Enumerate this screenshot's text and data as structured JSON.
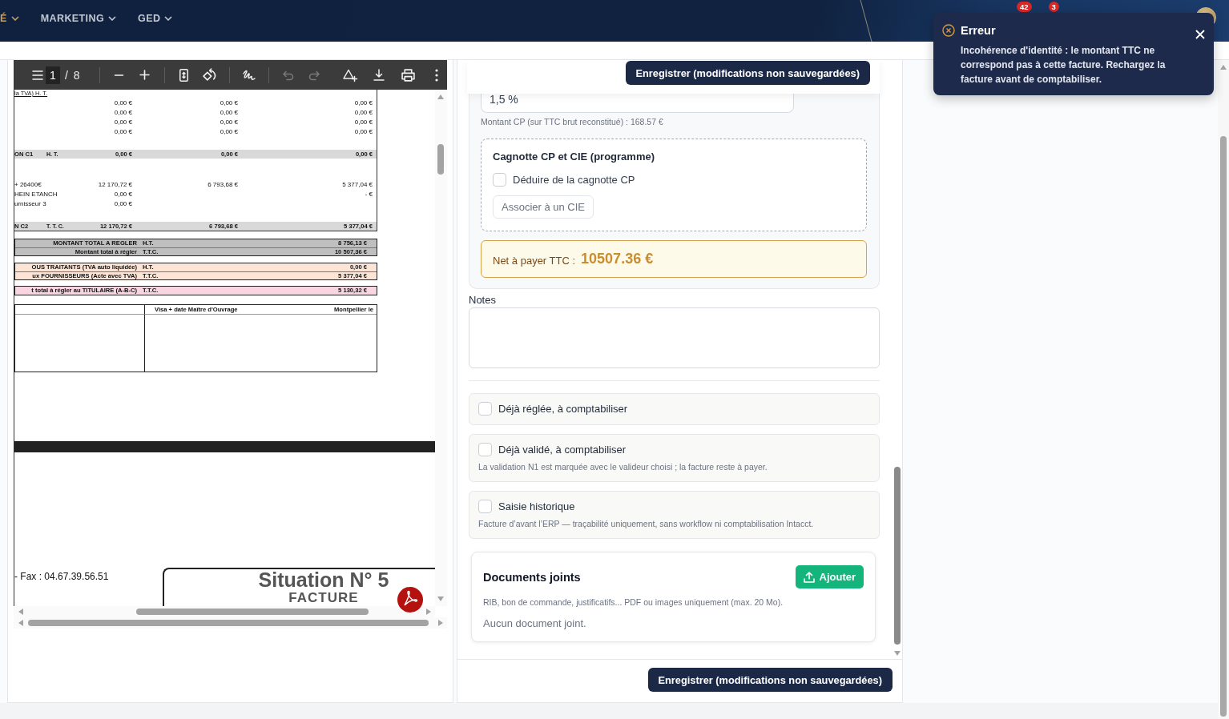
{
  "nav": {
    "items": [
      {
        "label": "É",
        "selected": true
      },
      {
        "label": "MARKETING",
        "selected": false
      },
      {
        "label": "GED",
        "selected": false
      }
    ],
    "badges": [
      "42",
      "3"
    ]
  },
  "pdf_viewer": {
    "toolbar": {
      "page_value": "1",
      "page_total": "/ 8",
      "tool_groups": [
        {
          "tools": [
            {
              "kind": "zoom-out",
              "disabled": false
            },
            {
              "kind": "zoom-in",
              "disabled": false
            }
          ]
        },
        {
          "tools": [
            {
              "kind": "fit-page",
              "disabled": false
            },
            {
              "kind": "rotate",
              "disabled": false
            }
          ]
        },
        {
          "tools": [
            {
              "kind": "draw",
              "disabled": false
            }
          ]
        },
        {
          "tools": [
            {
              "kind": "undo",
              "disabled": true
            },
            {
              "kind": "redo",
              "disabled": true
            }
          ]
        }
      ],
      "end_tools": [
        {
          "kind": "add-to-drive",
          "disabled": false
        },
        {
          "kind": "download",
          "disabled": false
        },
        {
          "kind": "print",
          "disabled": false
        },
        {
          "kind": "more",
          "disabled": false
        }
      ]
    },
    "document": {
      "heading": "la TVA) H. T.",
      "rows": [
        {
          "kind": "amounts",
          "col_1": "0,00 €",
          "col_2": "0,00 €",
          "col_3": "0,00 €"
        },
        {
          "kind": "amounts",
          "col_1": "0,00 €",
          "col_2": "0,00 €",
          "col_3": "0,00 €"
        },
        {
          "kind": "amounts",
          "col_1": "0,00 €",
          "col_2": "0,00 €",
          "col_3": "0,00 €"
        },
        {
          "kind": "amounts",
          "col_1": "0,00 €",
          "col_2": "0,00 €",
          "col_3": "0,00 €"
        },
        {
          "kind": "subtotal",
          "label": "ON C1",
          "unit": "H. T.",
          "col_1": "0,00 €",
          "col_2": "0,00 €",
          "col_3": "0,00 €"
        },
        {
          "kind": "amounts",
          "label": "+ 26400€",
          "col_1": "12 170,72 €",
          "col_2": "6 793,68 €",
          "col_3": "5 377,04 €"
        },
        {
          "kind": "amounts",
          "label": "HEIN ETANCH",
          "col_1": "0,00 €",
          "col_3": "- €"
        },
        {
          "kind": "amounts",
          "label": "urnisseur 3",
          "col_1": "0,00 €"
        },
        {
          "kind": "subtotal",
          "label": "N C2",
          "unit": "T. T. C.",
          "col_1": "12 170,72 €",
          "col_2": "6 793,68 €",
          "col_3": "5 377,04 €"
        }
      ],
      "total_blocks": [
        {
          "color": "#bfbfbf",
          "rows": [
            {
              "label": "MONTANT TOTAL A REGLER",
              "unit": "H.T.",
              "amount": "8 756,13 €"
            },
            {
              "label": "Montant total à régler",
              "unit": "T.T.C.",
              "amount": "10 507,36 €"
            }
          ]
        },
        {
          "color": "#fce4d6",
          "rows": [
            {
              "label": "OUS TRAITANTS (TVA auto liquidée)",
              "unit": "H.T.",
              "amount": "0,00 €"
            },
            {
              "label": "ux FOURNISSEURS (Acte avec TVA)",
              "unit": "T.T.C.",
              "amount": "5 377,04 €"
            }
          ]
        },
        {
          "color": "#f8d5e0",
          "rows": [
            {
              "label": "t total à régler au TITULAIRE (A-B-C)",
              "unit": "T.T.C.",
              "amount": "5 130,32 €"
            }
          ]
        }
      ],
      "signature_table": {
        "heading": "Visa + date Maître d'Ouvrage",
        "place": "Montpellier le"
      },
      "next_page": {
        "contact": "- Fax : 04.67.39.56.51",
        "title": "Situation N° 5",
        "subtitle": "FACTURE"
      }
    }
  },
  "form": {
    "top_button": "Enregistrer (modifications non sauvegardées)",
    "rate": {
      "value": "1,5 %",
      "hint": "Montant CP (sur TTC brut reconstitué) : 168.57 €"
    },
    "cagnotte": {
      "title": "Cagnotte CP et CIE (programme)",
      "checkbox": {
        "label": "Déduire de la cagnotte CP",
        "checked": false
      },
      "button": "Associer à un CIE"
    },
    "net_to_pay": {
      "label": "Net à payer TTC :",
      "amount": "10507.36 €"
    },
    "notes": {
      "label": "Notes"
    },
    "options": [
      {
        "label": "Déjà réglée, à comptabiliser",
        "checked": false
      },
      {
        "label": "Déjà validé, à comptabiliser",
        "checked": false,
        "hint": "La validation N1 est marquée avec le valideur choisi ; la facture reste à payer."
      },
      {
        "label": "Saisie historique",
        "checked": false,
        "hint": "Facture d’avant l’ERP — traçabilité uniquement, sans workflow ni comptabilisation Intacct."
      }
    ],
    "documents": {
      "title": "Documents joints",
      "button": "Ajouter",
      "hint": "RIB, bon de commande, justificatifs... PDF ou images uniquement (max. 20 Mo).",
      "empty": "Aucun document joint."
    },
    "footer_button": "Enregistrer (modifications non sauvegardées)"
  },
  "toast": {
    "title": "Erreur",
    "message": "Incohérence d'identité : le montant TTC ne correspond pas à cette facture. Rechargez la facture avant de comptabiliser."
  }
}
